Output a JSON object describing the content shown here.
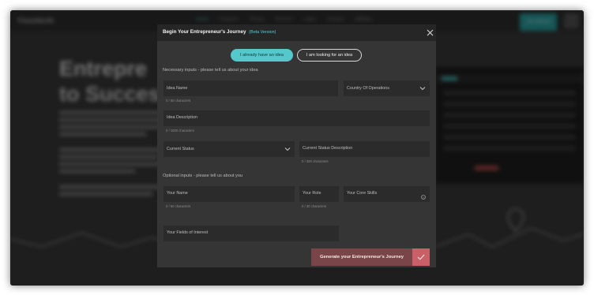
{
  "background": {
    "logo": "FounderAI",
    "nav_links": [
      "Home",
      "Features",
      "Pricing",
      "Success",
      "Learn",
      "Contact",
      "Affiliates"
    ],
    "cta_label": "Get Started",
    "hero_line1": "Entrepre",
    "hero_line2": "to Succes"
  },
  "modal": {
    "title": "Begin Your Entrepreneur's Journey",
    "beta": "(Beta Version)",
    "toggle_have": "I already have an idea",
    "toggle_look": "I am looking for an idea",
    "necessary_label": "Necessary inputs - please tell us about your idea",
    "optional_label": "Optional inputs - please tell us about you",
    "fields": {
      "idea_name": {
        "label": "Idea Name",
        "counter": "0 / 50 characters"
      },
      "country": {
        "label": "Country Of Operations"
      },
      "idea_description": {
        "label": "Idea Description",
        "counter": "0 / 1000 characters"
      },
      "current_status": {
        "label": "Current Status"
      },
      "status_description": {
        "label": "Current Status Description",
        "counter": "0 / 300 characters"
      },
      "your_name": {
        "label": "Your Name",
        "counter": "0 / 50 characters"
      },
      "your_role": {
        "label": "Your Role",
        "counter": "0 / 30 characters"
      },
      "core_skills": {
        "label": "Your Core Skills"
      },
      "fields_of_interest": {
        "label": "Your Fields of Interest"
      }
    },
    "generate_label": "Generate your Entrepreneur's Journey"
  },
  "colors": {
    "accent": "#55c8cb",
    "modal_bg": "#353535",
    "field_bg": "#2b2b2b",
    "generate_bg": "#7a4548",
    "generate_check_bg": "#c96067"
  },
  "icons": {
    "close": "close-icon",
    "dropdown": "chevron-down-icon",
    "info": "info-icon",
    "check": "check-icon"
  }
}
